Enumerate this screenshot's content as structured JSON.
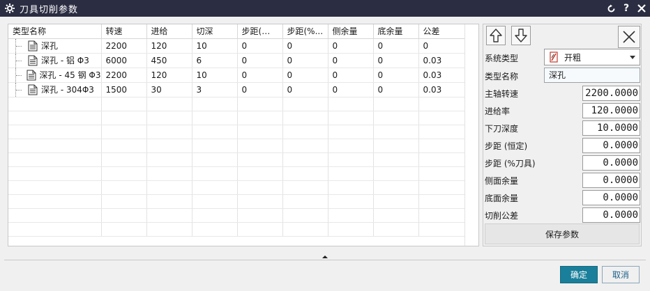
{
  "window": {
    "title": "刀具切削参数"
  },
  "table": {
    "columns": [
      "类型名称",
      "转速",
      "进给",
      "切深",
      "步距(恒...",
      "步距(%...",
      "侧余量",
      "底余量",
      "公差"
    ],
    "rows": [
      {
        "name": "深孔",
        "speed": "2200",
        "feed": "120",
        "depth": "10",
        "step_const": "0",
        "step_pct": "0",
        "side_stock": "0",
        "floor_stock": "0",
        "tolerance": "0"
      },
      {
        "name": "深孔 - 铝 Φ3",
        "speed": "6000",
        "feed": "450",
        "depth": "6",
        "step_const": "0",
        "step_pct": "0",
        "side_stock": "0",
        "floor_stock": "0",
        "tolerance": "0.03"
      },
      {
        "name": "深孔 - 45 钢 Φ3",
        "speed": "2200",
        "feed": "120",
        "depth": "10",
        "step_const": "0",
        "step_pct": "0",
        "side_stock": "0",
        "floor_stock": "0",
        "tolerance": "0.03"
      },
      {
        "name": "深孔 - 304Φ3",
        "speed": "1500",
        "feed": "30",
        "depth": "3",
        "step_const": "0",
        "step_pct": "0",
        "side_stock": "0",
        "floor_stock": "0",
        "tolerance": "0.03"
      }
    ]
  },
  "props": {
    "system_type_label": "系统类型",
    "system_type_value": "开粗",
    "type_name_label": "类型名称",
    "type_name_value": "深孔",
    "spindle_label": "主轴转速",
    "spindle_value": "2200.0000",
    "feed_label": "进给率",
    "feed_value": "120.0000",
    "depth_label": "下刀深度",
    "depth_value": "10.0000",
    "step_const_label": "步距 (恒定)",
    "step_const_value": "0.0000",
    "step_pct_label": "步距 (%刀具)",
    "step_pct_value": "0.0000",
    "side_stock_label": "侧面余量",
    "side_stock_value": "0.0000",
    "floor_stock_label": "底面余量",
    "floor_stock_value": "0.0000",
    "tolerance_label": "切削公差",
    "tolerance_value": "0.0000",
    "save_label": "保存参数"
  },
  "footer": {
    "ok_label": "确定",
    "cancel_label": "取消"
  },
  "colors": {
    "titlebar": "#2b2d42",
    "ok_button": "#1a7f9a"
  },
  "icons": [
    "gear-icon",
    "reset-icon",
    "help-icon",
    "close-icon",
    "document-icon",
    "arrow-up-icon",
    "arrow-down-icon",
    "clear-icon",
    "tool-icon",
    "collapse-arrow-icon"
  ]
}
